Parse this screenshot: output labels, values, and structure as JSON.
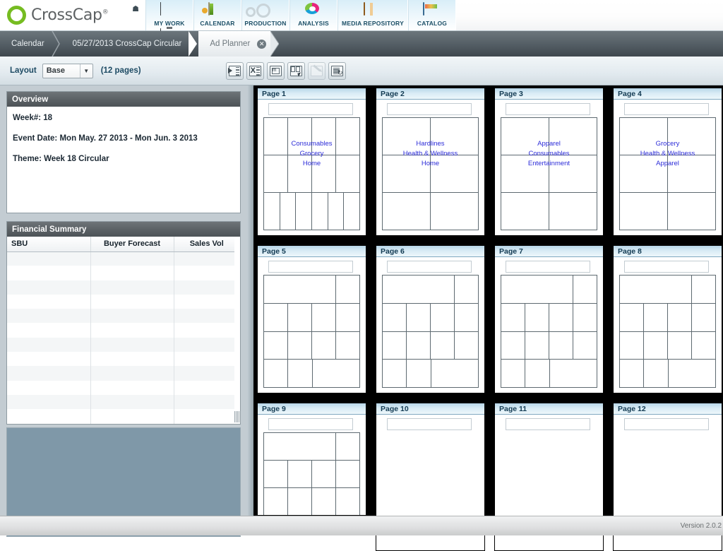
{
  "app": {
    "brand_name": "CrossCap",
    "brand_tm": "®",
    "home_icon": "home-icon",
    "version": "Version 2.0.2"
  },
  "topnav": {
    "items": [
      {
        "label": "MY WORK",
        "icon": "monitor-icon"
      },
      {
        "label": "CALENDAR",
        "icon": "calendar-icon"
      },
      {
        "label": "PRODUCTION",
        "icon": "gears-icon"
      },
      {
        "label": "ANALYSIS",
        "icon": "pie-chart-icon"
      },
      {
        "label": "MEDIA REPOSITORY",
        "icon": "box-icon"
      },
      {
        "label": "CATALOG",
        "icon": "catalog-icon"
      }
    ]
  },
  "breadcrumb": {
    "items": [
      {
        "label": "Calendar",
        "active": false
      },
      {
        "label": "05/27/2013 CrossCap Circular",
        "active": false
      },
      {
        "label": "Ad Planner",
        "active": true,
        "close_icon": "close-icon"
      }
    ]
  },
  "toolbar": {
    "layout_label": "Layout",
    "layout_value": "Base",
    "layout_options": [
      "Base"
    ],
    "page_count": "(12 pages)",
    "buttons": [
      {
        "name": "export-icon",
        "enabled": true
      },
      {
        "name": "export-excel-icon",
        "enabled": true
      },
      {
        "name": "page-setup-icon",
        "enabled": true
      },
      {
        "name": "select-pages-icon",
        "enabled": true
      },
      {
        "name": "edit-pencil-icon",
        "enabled": false
      },
      {
        "name": "refresh-report-icon",
        "enabled": true
      }
    ]
  },
  "overview": {
    "title": "Overview",
    "week": "Week#: 18",
    "event_date": "Event Date: Mon May. 27 2013 - Mon Jun. 3 2013",
    "theme": "Theme: Week 18 Circular"
  },
  "financial_summary": {
    "title": "Financial Summary",
    "columns": [
      "SBU",
      "Buyer Forecast",
      "Sales Vol"
    ],
    "rows": [
      [
        "",
        "",
        ""
      ],
      [
        "",
        "",
        ""
      ],
      [
        "",
        "",
        ""
      ],
      [
        "",
        "",
        ""
      ],
      [
        "",
        "",
        ""
      ],
      [
        "",
        "",
        ""
      ],
      [
        "",
        "",
        ""
      ],
      [
        "",
        "",
        ""
      ],
      [
        "",
        "",
        ""
      ],
      [
        "",
        "",
        ""
      ],
      [
        "",
        "",
        ""
      ],
      [
        "",
        "",
        ""
      ]
    ]
  },
  "pages": [
    {
      "title": "Page 1",
      "categories": [
        "Consumables",
        "Grocery",
        "Home"
      ],
      "layout": [
        [
          1,
          1,
          1,
          1
        ],
        [
          1,
          1,
          1,
          1
        ],
        [
          1,
          1,
          1,
          1,
          1,
          1
        ]
      ]
    },
    {
      "title": "Page 2",
      "categories": [
        "Hardlines",
        "Health & Wellness",
        "Home"
      ],
      "layout": [
        [
          1,
          1
        ],
        [
          1,
          1
        ],
        [
          1,
          1
        ]
      ]
    },
    {
      "title": "Page 3",
      "categories": [
        "Apparel",
        "Consumables",
        "Entertainment"
      ],
      "layout": [
        [
          1,
          1
        ],
        [
          1,
          1
        ],
        [
          1,
          1
        ]
      ]
    },
    {
      "title": "Page 4",
      "categories": [
        "Grocery",
        "Health & Wellness",
        "Apparel"
      ],
      "layout": [
        [
          1,
          1
        ],
        [
          1,
          1
        ],
        [
          1,
          1
        ]
      ]
    },
    {
      "title": "Page 5",
      "categories": [],
      "layout": [
        [
          3,
          1
        ],
        [
          1,
          1,
          1,
          1
        ],
        [
          1,
          1,
          1,
          1
        ],
        [
          1,
          1,
          2
        ]
      ]
    },
    {
      "title": "Page 6",
      "categories": [],
      "layout": [
        [
          3,
          1
        ],
        [
          1,
          1,
          1,
          1
        ],
        [
          1,
          1,
          1,
          1
        ],
        [
          1,
          1,
          2
        ]
      ]
    },
    {
      "title": "Page 7",
      "categories": [],
      "layout": [
        [
          3,
          1
        ],
        [
          1,
          1,
          1,
          1
        ],
        [
          1,
          1,
          1,
          1
        ],
        [
          1,
          1,
          2
        ]
      ]
    },
    {
      "title": "Page 8",
      "categories": [],
      "layout": [
        [
          3,
          1
        ],
        [
          1,
          1,
          1,
          1
        ],
        [
          1,
          1,
          1,
          1
        ],
        [
          1,
          1,
          2
        ]
      ]
    },
    {
      "title": "Page 9",
      "categories": [],
      "layout": [
        [
          3,
          1
        ],
        [
          1,
          1,
          1,
          1
        ],
        [
          1,
          1,
          1,
          1
        ]
      ]
    },
    {
      "title": "Page 10",
      "categories": [],
      "layout": []
    },
    {
      "title": "Page 11",
      "categories": [],
      "layout": []
    },
    {
      "title": "Page 12",
      "categories": [],
      "layout": []
    }
  ]
}
